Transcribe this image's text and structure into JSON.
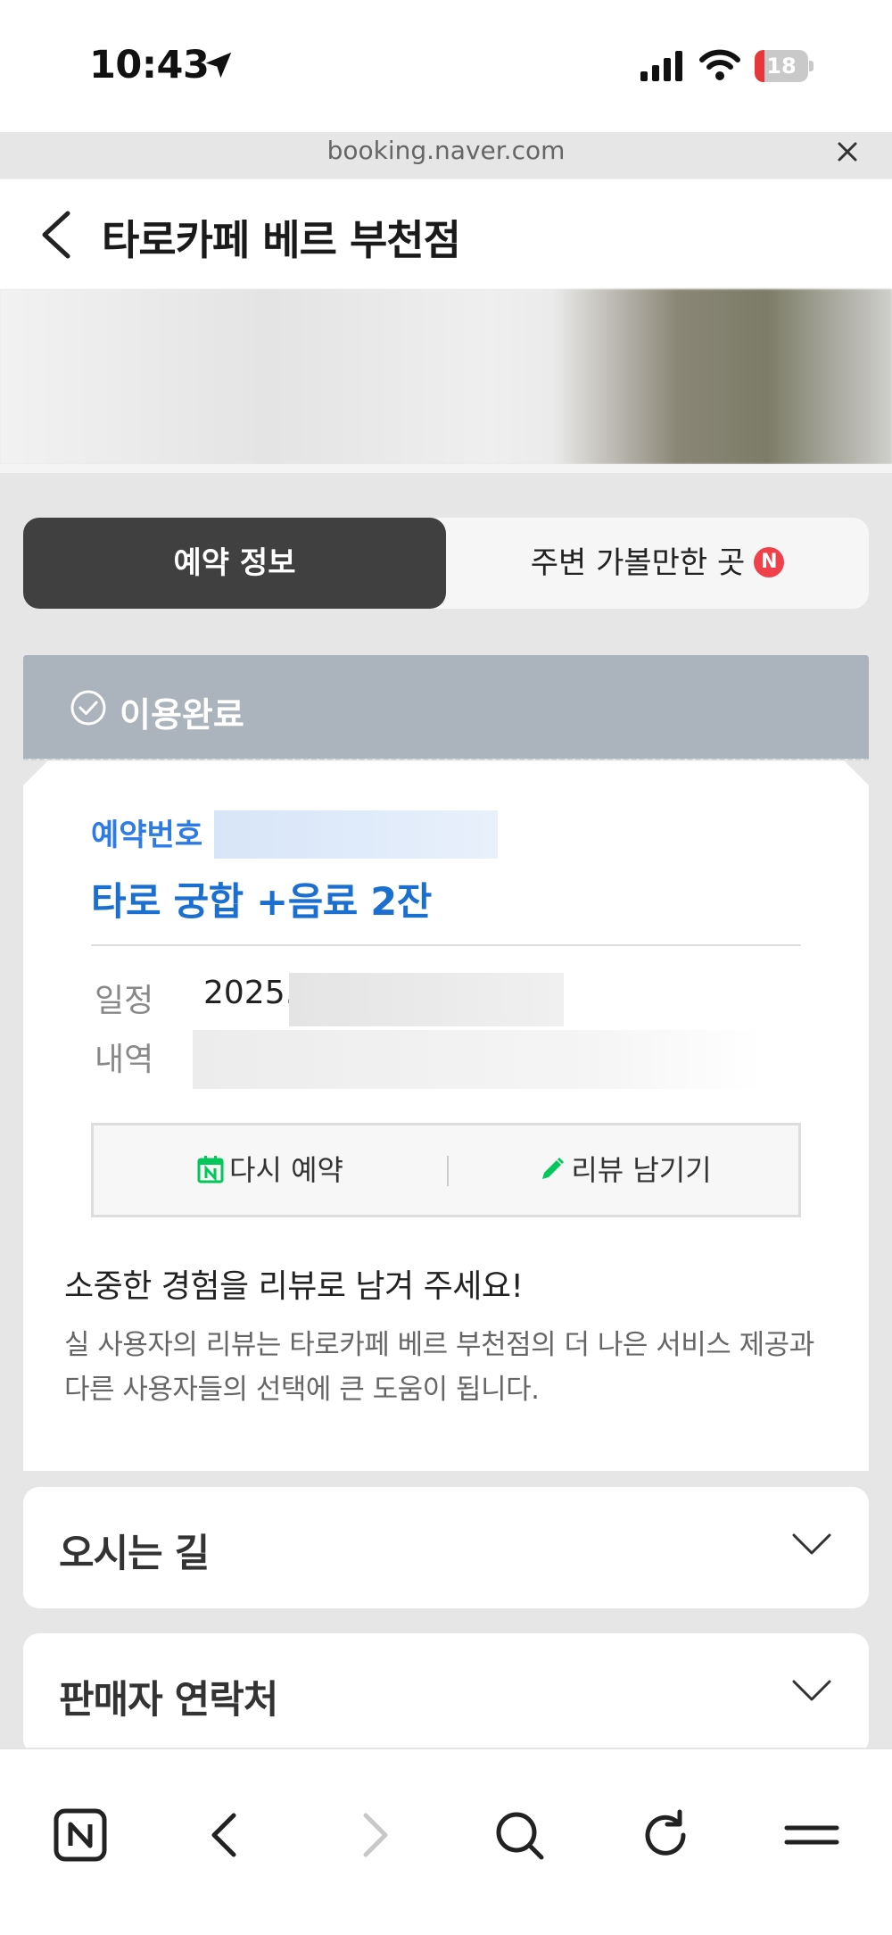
{
  "status_bar": {
    "time": "10:43",
    "battery": "18",
    "battery_level": 0.18
  },
  "browser": {
    "url": "booking.naver.com"
  },
  "header": {
    "title": "타로카페 베르 부천점"
  },
  "tabs": [
    {
      "label": "예약 정보",
      "active": true
    },
    {
      "label": "주변 가볼만한 곳",
      "badge": "N",
      "active": false
    }
  ],
  "booking": {
    "status": "이용완료",
    "number_label": "예약번호",
    "product": "타로 궁합 +음료 2잔",
    "rows": [
      {
        "label": "일정",
        "value": "2025."
      },
      {
        "label": "내역",
        "value": ""
      }
    ],
    "actions": {
      "rebook": "다시 예약",
      "review": "리뷰 남기기"
    },
    "review_prompt": {
      "title": "소중한 경험을 리뷰로 남겨 주세요!",
      "desc": "실 사용자의 리뷰는 타로카페 베르 부천점의 더 나은 서비스 제공과 다른 사용자들의 선택에 큰 도움이 됩니다."
    }
  },
  "sections": [
    {
      "title": "오시는 길"
    },
    {
      "title": "판매자 연락처"
    }
  ],
  "bottom_nav": [
    "naver-home-icon",
    "back-icon",
    "forward-icon",
    "search-icon",
    "refresh-icon",
    "menu-icon"
  ],
  "colors": {
    "accent_blue": "#1a6fd0",
    "status_band": "#abb3bc",
    "naver_green": "#03c75a",
    "badge_red": "#f0414a"
  }
}
